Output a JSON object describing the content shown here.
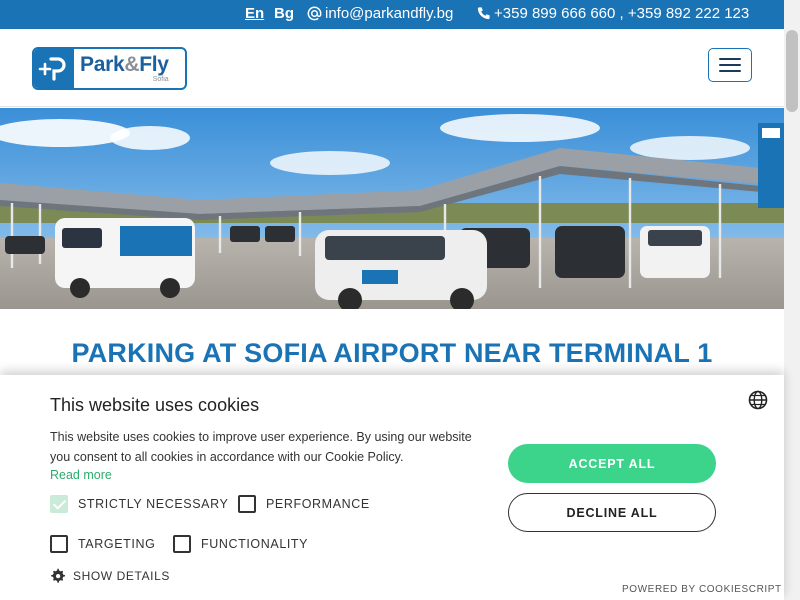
{
  "topbar": {
    "lang_en": "En",
    "lang_bg": "Bg",
    "email": "info@parkandfly.bg",
    "phones": "+359 899 666 660 , +359 892 222 123"
  },
  "header": {
    "logo_name_a": "Park",
    "logo_name_amp": "&",
    "logo_name_b": "Fly",
    "logo_city": "Sofia"
  },
  "main": {
    "title": "PARKING AT SOFIA AIRPORT NEAR TERMINAL 1"
  },
  "cookie_banner": {
    "title": "This website uses cookies",
    "description": "This website uses cookies to improve user experience. By using our website you consent to all cookies in accordance with our Cookie Policy.",
    "read_more": "Read more",
    "checkboxes": [
      {
        "label": "STRICTLY NECESSARY",
        "checked": true
      },
      {
        "label": "PERFORMANCE",
        "checked": false
      },
      {
        "label": "TARGETING",
        "checked": false
      },
      {
        "label": "FUNCTIONALITY",
        "checked": false
      }
    ],
    "show_details": "SHOW DETAILS",
    "accept_all": "ACCEPT ALL",
    "decline_all": "DECLINE ALL",
    "powered_by": "POWERED BY COOKIESCRIPT"
  },
  "colors": {
    "brand_blue": "#1a73b4",
    "accept_green": "#3cd38b",
    "link_green": "#2cab6b"
  }
}
